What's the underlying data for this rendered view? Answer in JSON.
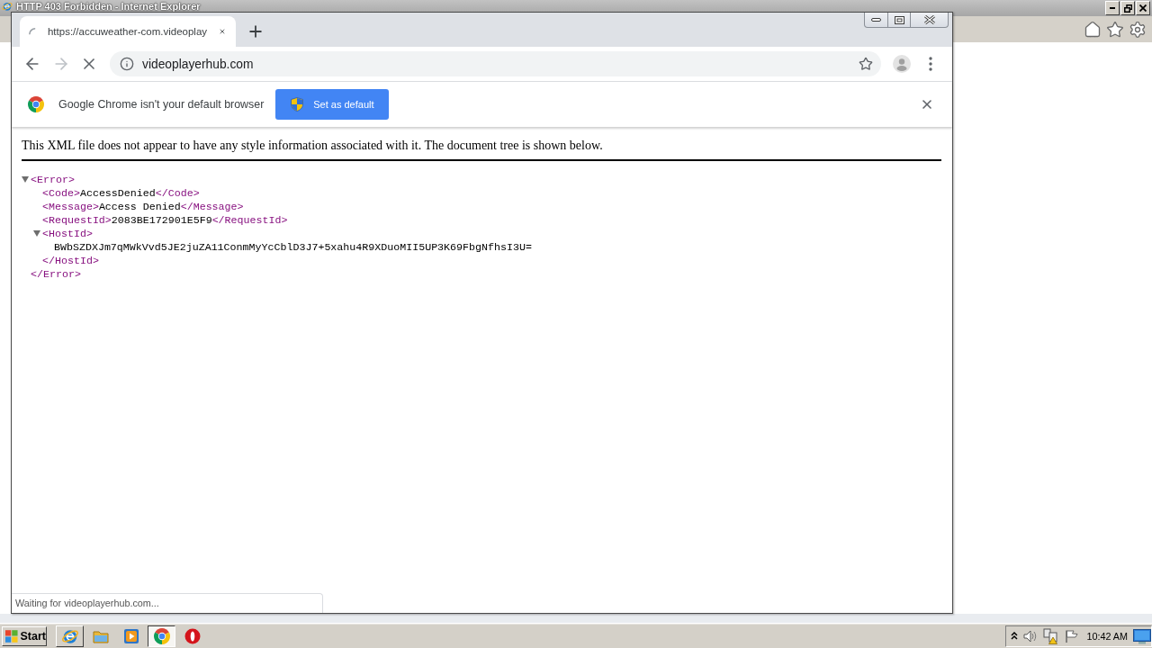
{
  "background_window": {
    "title": "HTTP 403 Forbidden - Internet Explorer"
  },
  "browser": {
    "tabs": [
      {
        "title": "https://accuweather-com.videoplay",
        "selected": true,
        "loading": true
      }
    ],
    "nav_buttons": [
      {
        "kind": "back",
        "disabled": false
      },
      {
        "kind": "forward",
        "disabled": true
      },
      {
        "kind": "stop",
        "disabled": false
      }
    ],
    "address_bar": {
      "url": "videoplayerhub.com"
    },
    "infobar": {
      "message": "Google Chrome isn't your default browser",
      "button": "Set as default"
    },
    "page": {
      "notice": "This XML file does not appear to have any style information associated with it. The document tree is shown below.",
      "xml_tree": [
        {
          "kind": "element",
          "open": "<Error>",
          "close": "</Error>",
          "expanded": true,
          "children": [
            {
              "kind": "leaf",
              "open": "<Code>",
              "text": "AccessDenied",
              "close": "</Code>"
            },
            {
              "kind": "leaf",
              "open": "<Message>",
              "text": "Access Denied",
              "close": "</Message>"
            },
            {
              "kind": "leaf",
              "open": "<RequestId>",
              "text": "2083BE172901E5F9",
              "close": "</RequestId>"
            },
            {
              "kind": "element",
              "open": "<HostId>",
              "close": "</HostId>",
              "expanded": true,
              "children": [
                {
                  "kind": "text",
                  "text": "BWbSZDXJm7qMWkVvd5JE2juZA11ConmMyYcCblD3J7+5xahu4R9XDuoMII5UP3K69FbgNfhsI3U="
                }
              ]
            }
          ]
        }
      ]
    },
    "status": "Waiting for videoplayerhub.com..."
  },
  "taskbar": {
    "start": "Start",
    "apps": [
      {
        "kind": "ie",
        "running": true,
        "selected": false
      },
      {
        "kind": "folder",
        "running": false,
        "selected": false
      },
      {
        "kind": "media",
        "running": false,
        "selected": false
      },
      {
        "kind": "chrome",
        "running": true,
        "selected": true
      },
      {
        "kind": "ring",
        "running": false,
        "selected": false
      }
    ],
    "clock": "10:42 AM"
  }
}
